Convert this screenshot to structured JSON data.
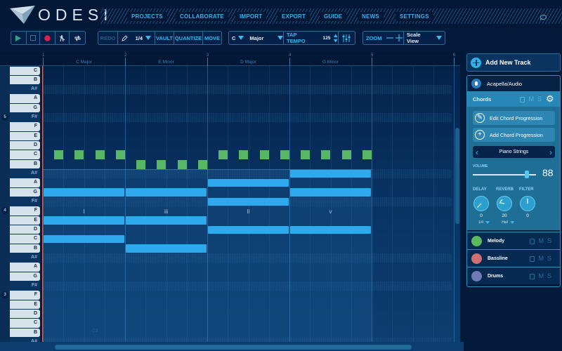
{
  "app": {
    "name": "ODESI"
  },
  "nav": {
    "items": [
      "PROJECTS",
      "COLLABORATE",
      "IMPORT",
      "EXPORT",
      "GUIDE",
      "NEWS",
      "SETTINGS"
    ],
    "chat_icon": "chat-bubble-icon"
  },
  "toolbar": {
    "transport": {
      "play": "play-icon",
      "stop": "stop-icon",
      "record": "record-icon",
      "metronome": "metronome-icon",
      "loop": "loop-icon"
    },
    "redo": "REDO",
    "note_length": "1/4",
    "vault": "VAULT",
    "quantize": "QUANTIZE",
    "move": "MOVE",
    "key": "C",
    "scale": "Major",
    "tap_tempo": "TAP TEMPO",
    "tempo": "125",
    "zoom": "ZOOM",
    "view": "Scale View"
  },
  "ruler": {
    "bars": [
      "1",
      "2",
      "3",
      "4",
      "5",
      "6"
    ],
    "chords": [
      "C Major",
      "E Minor",
      "D Major",
      "G Minor"
    ]
  },
  "keyboard": {
    "keys": [
      "C",
      "B",
      "A#",
      "A",
      "G",
      "F#",
      "F",
      "E",
      "D",
      "C",
      "B",
      "A#",
      "A",
      "G",
      "F#",
      "F",
      "E",
      "D",
      "C",
      "B",
      "A#",
      "A",
      "G",
      "F#",
      "F",
      "E",
      "D",
      "C",
      "B",
      "A#"
    ],
    "octaves": [
      {
        "label": "5",
        "row": 5
      },
      {
        "label": "4",
        "row": 15
      },
      {
        "label": "3",
        "row": 24
      }
    ]
  },
  "grid": {
    "c3_label": "C3",
    "roman_numerals": [
      "I",
      "iii",
      "II",
      "v"
    ],
    "chord_notes": [
      {
        "bar": 1,
        "rows": [
          13,
          16,
          18
        ]
      },
      {
        "bar": 2,
        "rows": [
          13,
          16,
          19
        ]
      },
      {
        "bar": 3,
        "rows": [
          12,
          14,
          17
        ]
      },
      {
        "bar": 4,
        "rows": [
          11,
          13,
          17
        ]
      }
    ],
    "melody_notes": [
      {
        "bar": 1,
        "row": 9
      },
      {
        "bar": 2,
        "row": 10
      },
      {
        "bar": 3,
        "row": 9
      },
      {
        "bar": 4,
        "row": 9
      }
    ],
    "beats_per_bar": 4
  },
  "panel": {
    "add_track": "Add New Track",
    "audio_track": "Acapella/Audio",
    "chords_track": "Chords",
    "lock": "lock-icon",
    "mute": "M",
    "solo": "S",
    "edit_chord": "Edit Chord Progression",
    "add_chord": "Add Chord Progression",
    "instrument": "Piano Strings",
    "volume_label": "VOLUME",
    "volume": "88",
    "volume_fraction": 0.88,
    "fx": [
      {
        "label": "DELAY",
        "value": "0",
        "sub": "1/4"
      },
      {
        "label": "REVERB",
        "value": "20",
        "sub": "Hall"
      },
      {
        "label": "FILTER",
        "value": "0",
        "sub": ""
      }
    ],
    "tracks": [
      {
        "name": "Melody",
        "color": "#5cb85c"
      },
      {
        "name": "Bassline",
        "color": "#d07070"
      },
      {
        "name": "Drums",
        "color": "#6f7bb5"
      }
    ]
  },
  "colors": {
    "accent": "#35b1ea",
    "chord_note": "#2fa9ee",
    "melody_note": "#57b765",
    "record": "#d1244f",
    "play": "#2fa385"
  }
}
